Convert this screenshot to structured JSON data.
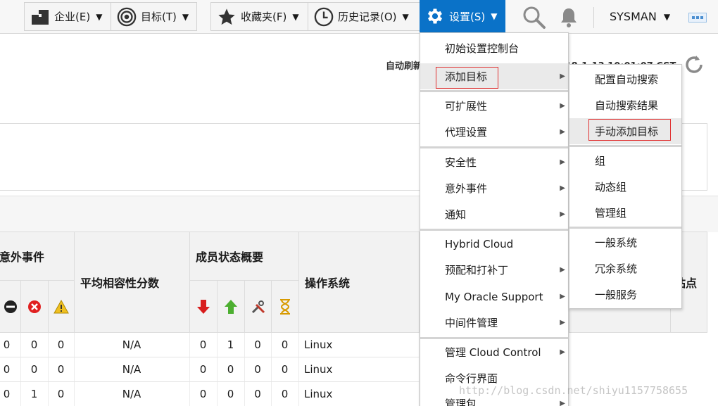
{
  "toolbar": {
    "enterprise": "企业(E)",
    "targets": "目标(T)",
    "favorites": "收藏夹(F)",
    "history": "历史记录(O)",
    "setup": "设置(S)",
    "user": "SYSMAN"
  },
  "page": {
    "auto_refresh": "自动刷新",
    "timestamp_partial": "2018-1-13 10:01:07 CST"
  },
  "table": {
    "headers": {
      "incidents": "意外事件",
      "avg_compat": "平均相容性分数",
      "member_status": "成员状态概要",
      "os": "操作系统",
      "site_partial": "站点"
    },
    "rows": [
      {
        "c1": "0",
        "c2": "0",
        "c3": "0",
        "score": "N/A",
        "m1": "0",
        "m2": "1",
        "m3": "0",
        "m4": "0",
        "os": "Linux"
      },
      {
        "c1": "0",
        "c2": "0",
        "c3": "0",
        "score": "N/A",
        "m1": "0",
        "m2": "0",
        "m3": "0",
        "m4": "0",
        "os": "Linux"
      },
      {
        "c1": "0",
        "c2": "1",
        "c3": "0",
        "score": "N/A",
        "m1": "0",
        "m2": "0",
        "m3": "0",
        "m4": "0",
        "os": "Linux"
      }
    ]
  },
  "setup_menu": {
    "items": [
      "初始设置控制台",
      "添加目标",
      "可扩展性",
      "代理设置",
      "安全性",
      "意外事件",
      "通知",
      "Hybrid Cloud",
      "预配和打补丁",
      "My Oracle Support",
      "中间件管理",
      "管理 Cloud Control",
      "命令行界面",
      "管理包"
    ]
  },
  "add_target_submenu": {
    "items": [
      "配置自动搜索",
      "自动搜索结果",
      "手动添加目标",
      "组",
      "动态组",
      "管理组",
      "一般系统",
      "冗余系统",
      "一般服务"
    ]
  },
  "watermark": "http://blog.csdn.net/shiyu1157758655",
  "colors": {
    "accent": "#0a72c8",
    "highlight_box": "#e03030"
  }
}
